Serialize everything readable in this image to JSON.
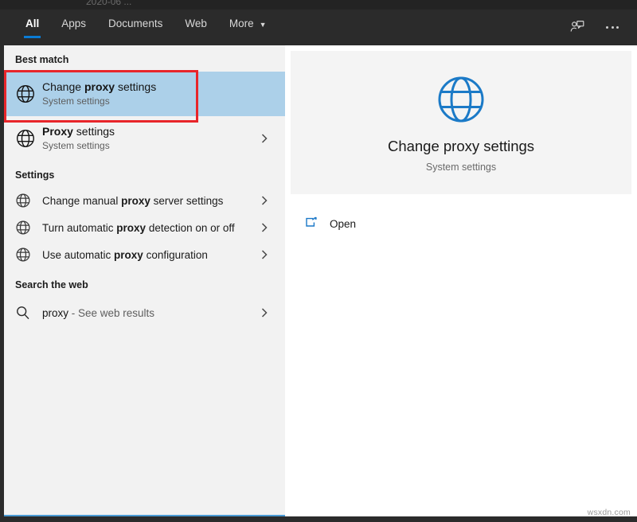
{
  "window": {
    "top_partial_text": "2020-06 ...",
    "watermark": "wsxdn.com"
  },
  "header": {
    "tabs": [
      {
        "label": "All",
        "active": true
      },
      {
        "label": "Apps",
        "active": false
      },
      {
        "label": "Documents",
        "active": false
      },
      {
        "label": "Web",
        "active": false
      },
      {
        "label": "More",
        "active": false,
        "caret": "▼"
      }
    ],
    "feedback_icon": "feedback-person-icon",
    "more_icon": "ellipsis-icon",
    "accent_color": "#0a7bd4"
  },
  "results": {
    "best_match": {
      "heading": "Best match",
      "item": {
        "title_prefix": "Change ",
        "title_bold": "proxy",
        "title_suffix": " settings",
        "subtitle": "System settings",
        "icon": "globe-icon",
        "selected": true,
        "highlight_color": "#acd0e9"
      }
    },
    "second_item": {
      "title_prefix": "",
      "title_bold": "Proxy",
      "title_suffix": " settings",
      "subtitle": "System settings",
      "icon": "globe-icon",
      "chevron": "chevron-right-icon"
    },
    "settings": {
      "heading": "Settings",
      "items": [
        {
          "prefix": "Change manual ",
          "bold": "proxy",
          "suffix": " server settings",
          "icon": "globe-icon",
          "chevron": "chevron-right-icon"
        },
        {
          "prefix": "Turn automatic ",
          "bold": "proxy",
          "suffix": " detection on or off",
          "icon": "globe-icon",
          "chevron": "chevron-right-icon"
        },
        {
          "prefix": "Use automatic ",
          "bold": "proxy",
          "suffix": " configuration",
          "icon": "globe-icon",
          "chevron": "chevron-right-icon"
        }
      ]
    },
    "search_web": {
      "heading": "Search the web",
      "item": {
        "query": "proxy",
        "suffix": " - See web results",
        "icon": "search-icon",
        "chevron": "chevron-right-icon"
      }
    }
  },
  "preview": {
    "icon": "globe-icon-blue",
    "title": "Change proxy settings",
    "subtitle": "System settings",
    "actions": [
      {
        "label": "Open",
        "icon": "open-external-icon"
      }
    ]
  },
  "annotation": {
    "color": "#e8252a",
    "target": "best-match-result"
  }
}
